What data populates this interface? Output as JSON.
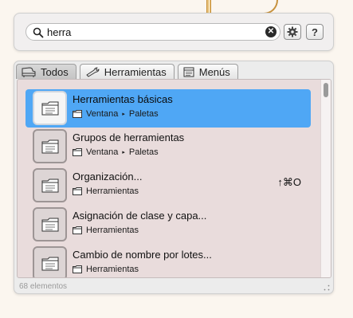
{
  "search": {
    "query": "herra",
    "clear_glyph": "✕",
    "gear_icon": "gear-icon",
    "help_label": "?"
  },
  "tabs": [
    {
      "label": "Todos",
      "icon": "piano-icon",
      "active": true
    },
    {
      "label": "Herramientas",
      "icon": "wrench-icon",
      "active": false
    },
    {
      "label": "Menús",
      "icon": "menu-icon",
      "active": false
    }
  ],
  "results": [
    {
      "title": "Herramientas básicas",
      "path": [
        "Ventana",
        "Paletas"
      ],
      "shortcut": "",
      "selected": true
    },
    {
      "title": "Grupos de herramientas",
      "path": [
        "Ventana",
        "Paletas"
      ],
      "shortcut": "",
      "selected": false
    },
    {
      "title": "Organización...",
      "path": [
        "Herramientas"
      ],
      "shortcut": "↑⌘O",
      "selected": false
    },
    {
      "title": "Asignación de clase y capa...",
      "path": [
        "Herramientas"
      ],
      "shortcut": "",
      "selected": false
    },
    {
      "title": "Cambio de nombre por lotes...",
      "path": [
        "Herramientas"
      ],
      "shortcut": "",
      "selected": false
    }
  ],
  "status": {
    "count_label": "68 elementos"
  },
  "colors": {
    "selection": "#4fa7f5",
    "list_bg": "#e9dcdc",
    "panel_bg": "#ececec"
  }
}
